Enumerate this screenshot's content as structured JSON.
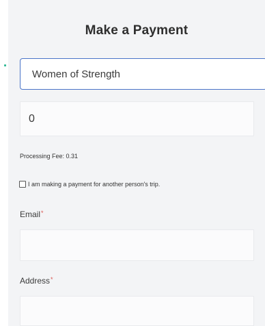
{
  "form": {
    "title": "Make a Payment",
    "campaign_value": "Women of Strength",
    "amount_value": "0",
    "processing_fee": "Processing Fee: 0.31",
    "other_person_label": "I am making a payment for another person's trip.",
    "email_label": "Email",
    "email_value": "",
    "address_label": "Address",
    "address_value": "",
    "required_marker": "*"
  },
  "colors": {
    "accent_border": "#4a74c8",
    "required": "#d9534f",
    "panel_bg": "#f3f4f6"
  }
}
